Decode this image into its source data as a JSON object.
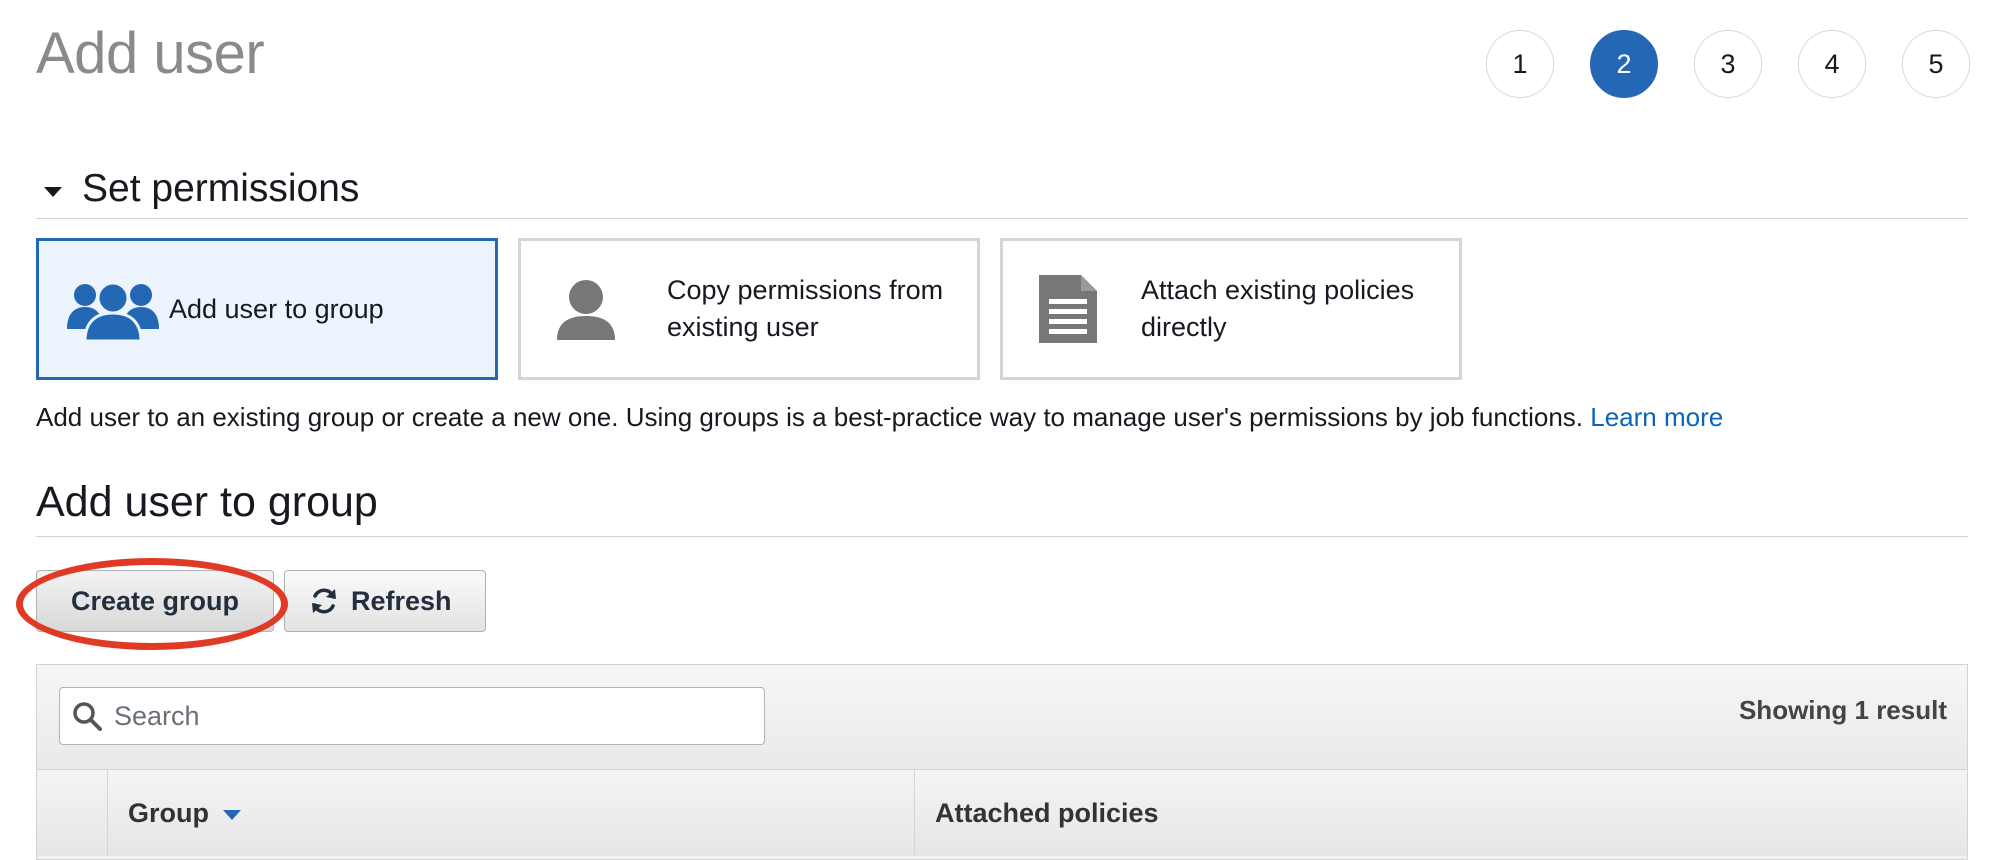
{
  "page": {
    "title": "Add user"
  },
  "wizard": {
    "steps": [
      "1",
      "2",
      "3",
      "4",
      "5"
    ],
    "current_step": 2
  },
  "permissions": {
    "section_title": "Set permissions",
    "options": [
      {
        "label": "Add user to group",
        "icon": "users-group-icon",
        "selected": true
      },
      {
        "label": "Copy permissions from existing user",
        "icon": "user-icon",
        "selected": false
      },
      {
        "label": "Attach existing policies directly",
        "icon": "document-icon",
        "selected": false
      }
    ],
    "help_text": "Add user to an existing group or create a new one. Using groups is a best-practice way to manage user's permissions by job functions.",
    "learn_more": "Learn more"
  },
  "group_section": {
    "title": "Add user to group",
    "create_button": "Create group",
    "refresh_button": "Refresh"
  },
  "table": {
    "search_placeholder": "Search",
    "result_count": "Showing 1 result",
    "columns": [
      "Group",
      "Attached policies"
    ]
  },
  "colors": {
    "accent": "#2467b5",
    "link": "#0b64b8",
    "highlight": "#e03a24",
    "selected_bg": "#ecf4fd"
  }
}
